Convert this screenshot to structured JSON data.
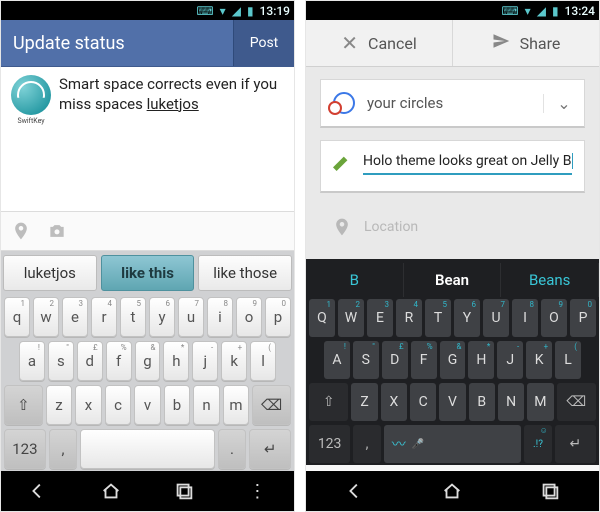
{
  "left": {
    "status": {
      "time": "13:19"
    },
    "header": {
      "title": "Update status",
      "post_btn": "Post"
    },
    "compose": {
      "logo_caption": "SwiftKey",
      "text_plain": "Smart space corrects even if you miss spaces ",
      "text_underlined": "luketjos"
    },
    "suggestions": [
      "luketjos",
      "like this",
      "like those"
    ],
    "keyboard": {
      "row1": [
        "q",
        "w",
        "e",
        "r",
        "t",
        "y",
        "u",
        "i",
        "o",
        "p"
      ],
      "row1_sub": [
        "1",
        "2",
        "3",
        "4",
        "5",
        "6",
        "7",
        "8",
        "9",
        "0"
      ],
      "row2": [
        "a",
        "s",
        "d",
        "f",
        "g",
        "h",
        "j",
        "k",
        "l"
      ],
      "row2_sub": [
        "!",
        "\"",
        "£",
        "%",
        "&",
        "*",
        "-",
        "+",
        "("
      ],
      "row3": [
        "z",
        "x",
        "c",
        "v",
        "b",
        "n",
        "m"
      ],
      "shift": "⇧",
      "bksp": "⌫",
      "sym": "123",
      "comma": ",",
      "period": ".",
      "enter": "↵"
    }
  },
  "right": {
    "status": {
      "time": "13:24"
    },
    "actions": {
      "cancel": "Cancel",
      "share": "Share"
    },
    "circles_label": "your circles",
    "post_text": "Holo theme looks great on Jelly B",
    "location_placeholder": "Location",
    "suggestions": [
      "B",
      "Bean",
      "Beans"
    ],
    "keyboard": {
      "row1": [
        "Q",
        "W",
        "E",
        "R",
        "T",
        "Y",
        "U",
        "I",
        "O",
        "P"
      ],
      "row1_sub": [
        "1",
        "2",
        "3",
        "4",
        "5",
        "6",
        "7",
        "8",
        "9",
        "0"
      ],
      "row2": [
        "A",
        "S",
        "D",
        "F",
        "G",
        "H",
        "J",
        "K",
        "L"
      ],
      "row2_sub": [
        "!",
        "\"",
        "£",
        "%",
        "&",
        "*",
        "-",
        "+",
        "("
      ],
      "row3": [
        "Z",
        "X",
        "C",
        "V",
        "B",
        "N",
        "M"
      ],
      "shift": "⇧",
      "bksp": "⌫",
      "sym": "123",
      "comma": ",",
      "period": ".!?",
      "enter": "↵"
    }
  },
  "colors": {
    "fb_header": "#5170a9",
    "holo_accent": "#2f9dbf",
    "dark_key_accent": "#39c5d6"
  }
}
